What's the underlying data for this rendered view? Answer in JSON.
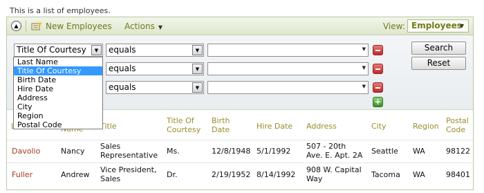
{
  "intro_text": "This is a list of employees.",
  "toolbar": {
    "new_label": "New Employees",
    "actions_label": "Actions",
    "view_label": "View:",
    "view_value": "Employees"
  },
  "filters": [
    {
      "field": "Title Of Courtesy",
      "operator": "equals",
      "value": ""
    },
    {
      "field": "",
      "operator": "equals",
      "value": ""
    },
    {
      "field": "",
      "operator": "equals",
      "value": ""
    }
  ],
  "buttons": {
    "search": "Search",
    "reset": "Reset"
  },
  "field_options": [
    "Last Name",
    "Title Of Courtesy",
    "Birth Date",
    "Hire Date",
    "Address",
    "City",
    "Region",
    "Postal Code"
  ],
  "selected_option_index": 1,
  "columns": {
    "last_name": "L",
    "first_name": "Name",
    "title": "Title",
    "courtesy": [
      "Title Of",
      "Courtesy"
    ],
    "birth": [
      "Birth",
      "Date"
    ],
    "hire": "Hire Date",
    "address": "Address",
    "city": "City",
    "region": "Region",
    "postal": [
      "Postal",
      "Code"
    ]
  },
  "rows": [
    {
      "last_name": "Davolio",
      "first_name": "Nancy",
      "title": [
        "Sales",
        "Representative"
      ],
      "courtesy": "Ms.",
      "birth": "12/8/1948",
      "hire": "5/1/1992",
      "address": [
        "507 - 20th",
        "Ave. E. Apt. 2A"
      ],
      "city": "Seattle",
      "region": "WA",
      "postal": "98122"
    },
    {
      "last_name": "Fuller",
      "first_name": "Andrew",
      "title": [
        "Vice President,",
        "Sales"
      ],
      "courtesy": "Dr.",
      "birth": "2/19/1952",
      "hire": "8/14/1992",
      "address": [
        "908 W. Capital",
        "Way"
      ],
      "city": "Tacoma",
      "region": "WA",
      "postal": "98401"
    }
  ],
  "colors": {
    "accent": "#6f7b1c",
    "header": "#9a8c2b",
    "link": "#a23a1b",
    "selection": "#3399ff"
  }
}
